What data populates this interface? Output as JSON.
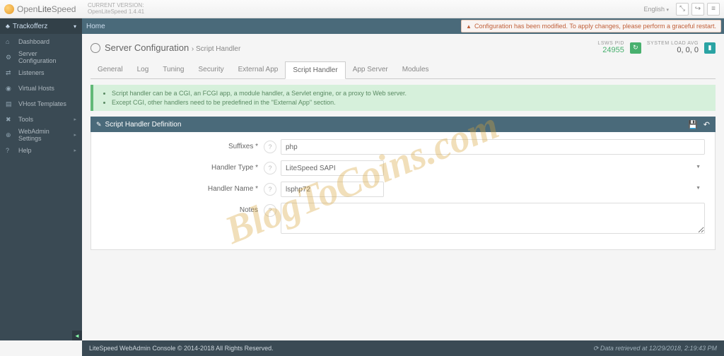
{
  "brand": {
    "name_a": "Open",
    "name_b": "Lite",
    "name_c": "Speed"
  },
  "version": {
    "label": "CURRENT VERSION:",
    "value": "OpenLiteSpeed 1.4.41"
  },
  "lang": "English",
  "nav_head": "Trackofferz",
  "breadcrumb_home": "Home",
  "alert": "Configuration has been modified. To apply changes, please perform a graceful restart.",
  "nav": [
    {
      "icon": "⌂",
      "label": "Dashboard"
    },
    {
      "icon": "⚙",
      "label": "Server Configuration"
    },
    {
      "icon": "⇄",
      "label": "Listeners"
    },
    {
      "icon": "◉",
      "label": "Virtual Hosts"
    },
    {
      "icon": "▤",
      "label": "VHost Templates"
    },
    {
      "icon": "✖",
      "label": "Tools",
      "caret": true
    },
    {
      "icon": "⊕",
      "label": "WebAdmin Settings",
      "caret": true
    },
    {
      "icon": "?",
      "label": "Help",
      "caret": true
    }
  ],
  "page": {
    "title": "Server Configuration",
    "crumb": "Script Handler"
  },
  "stats": {
    "pid_label": "LSWS PID",
    "pid_value": "24955",
    "load_label": "SYSTEM LOAD AVG",
    "load_value": "0, 0, 0"
  },
  "tabs": [
    "General",
    "Log",
    "Tuning",
    "Security",
    "External App",
    "Script Handler",
    "App Server",
    "Modules"
  ],
  "active_tab": 5,
  "info": [
    "Script handler can be a CGI, an FCGI app, a module handler, a Servlet engine, or a proxy to Web server.",
    "Except CGI, other handlers need to be predefined in the \"External App\" section."
  ],
  "panel_title": "Script Handler Definition",
  "form": {
    "suffixes_label": "Suffixes *",
    "suffixes_value": "php",
    "type_label": "Handler Type *",
    "type_value": "LiteSpeed SAPI",
    "name_label": "Handler Name *",
    "name_value": "lsphp72",
    "notes_label": "Notes",
    "notes_value": ""
  },
  "footer": {
    "left": "LiteSpeed WebAdmin Console © 2014-2018 All Rights Reserved.",
    "right": "Data retrieved at 12/29/2018, 2:19:43 PM"
  },
  "watermark": "BlogToCoins.com"
}
